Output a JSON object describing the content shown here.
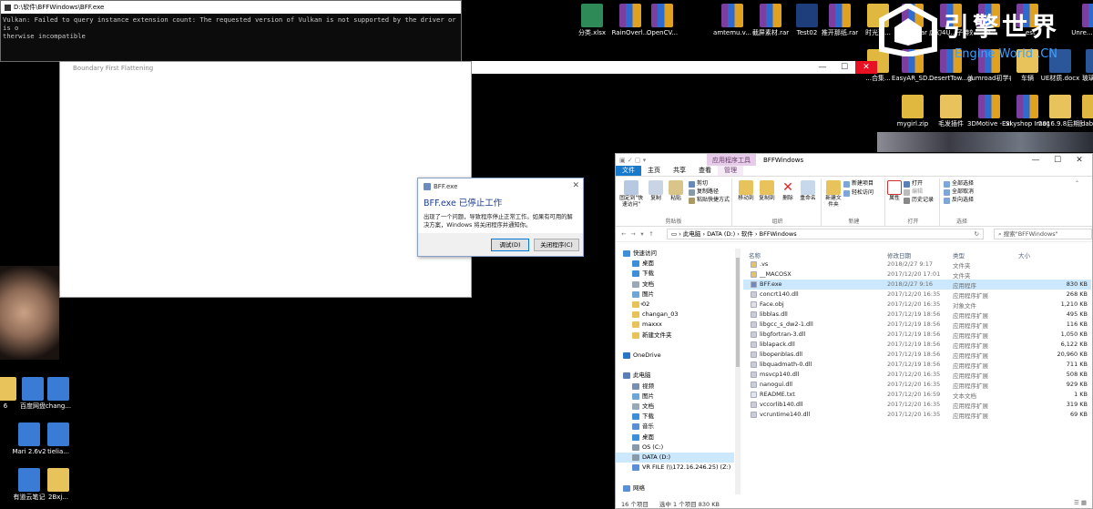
{
  "console": {
    "title": "D:\\软件\\BFFWindows\\BFF.exe",
    "output": "Vulkan: Failed to query instance extension count: The requested version of Vulkan is not supported by the driver or is o\ntherwise incompatible"
  },
  "bff_window": {
    "title": "Boundary First Flattening"
  },
  "dialog": {
    "title": "BFF.exe",
    "heading": "BFF.exe 已停止工作",
    "message": "出现了一个问题，导致程序停止正常工作。如果有可用的解决方案，Windows 将关闭程序并通知你。",
    "debug_label": "调试(D)",
    "close_label": "关闭程序(C)"
  },
  "watermark": {
    "cn": "引擎世界",
    "en": "Engine World .CN"
  },
  "desktop_icons": [
    {
      "label": "分类.xlsx",
      "kind": "xls"
    },
    {
      "label": "RainOverl...",
      "kind": "rar"
    },
    {
      "label": "OpenCV...",
      "kind": "rar"
    },
    {
      "label": "amtemu.v...",
      "kind": "rar"
    },
    {
      "label": "截屏素材.rar",
      "kind": "rar"
    },
    {
      "label": "Test02",
      "kind": "uico"
    },
    {
      "label": "推开那纸.rar",
      "kind": "rar"
    },
    {
      "label": "时光荒...",
      "kind": "zip"
    },
    {
      "label": "game.rar",
      "kind": "rar"
    },
    {
      "label": "虚幻4U...子特效源...",
      "kind": "rar"
    },
    {
      "label": "...4...",
      "kind": "rar"
    },
    {
      "label": "...est",
      "kind": "rar"
    },
    {
      "label": "Unre... Engi...",
      "kind": "rar"
    },
    {
      "label": "...合集...",
      "kind": "zip"
    },
    {
      "label": "EasyAR_SD...",
      "kind": "rar"
    },
    {
      "label": "DesertTow...沙漠村庄.7z",
      "kind": "rar"
    },
    {
      "label": "gumroad初学者场景...",
      "kind": "rar"
    },
    {
      "label": "车辆",
      "kind": "folder"
    },
    {
      "label": "UE材质.docx",
      "kind": "doc"
    },
    {
      "label": "玻璃...pdf",
      "kind": "doc"
    },
    {
      "label": "mygirl.zip",
      "kind": "zip"
    },
    {
      "label": "毛发插件",
      "kind": "folder"
    },
    {
      "label": "3DMotive -Exterior En...",
      "kind": "rar"
    },
    {
      "label": "Skyshop Image-Ba...",
      "kind": "rar"
    },
    {
      "label": "2016.9.8后期图片",
      "kind": "folder"
    },
    {
      "label": "dabai...",
      "kind": "zip"
    },
    {
      "label": "百度网盘",
      "kind": "app"
    },
    {
      "label": "chang...",
      "kind": "app"
    },
    {
      "label": "Mari 2.6v2",
      "kind": "app"
    },
    {
      "label": "tielia...",
      "kind": "app"
    },
    {
      "label": "有道云笔记",
      "kind": "app"
    },
    {
      "label": "2Bxj...",
      "kind": "folder"
    },
    {
      "label": "6",
      "kind": "folder"
    }
  ],
  "explorer": {
    "title": "BFFWindows",
    "context_tab": "应用程序工具",
    "tabs": [
      "文件",
      "主页",
      "共享",
      "查看",
      "管理"
    ],
    "ribbon": {
      "pin": "固定到\"快速访问\"",
      "copy": "复制",
      "paste": "粘贴",
      "cut": "剪切",
      "copy_path": "复制路径",
      "paste_shortcut": "粘贴快捷方式",
      "clipboard": "剪贴板",
      "move_to": "移动到",
      "copy_to": "复制到",
      "delete": "删除",
      "rename": "重命名",
      "organize": "组织",
      "new_folder": "新建文件夹",
      "new_item": "新建项目",
      "easy_access": "轻松访问",
      "new_group": "新建",
      "properties": "属性",
      "open": "打开",
      "edit": "编辑",
      "history": "历史记录",
      "open_group": "打开",
      "select_all": "全部选择",
      "select_none": "全部取消",
      "invert": "反向选择",
      "select_group": "选择"
    },
    "address": [
      "此电脑",
      "DATA (D:)",
      "软件",
      "BFFWindows"
    ],
    "search_placeholder": "搜索\"BFFWindows\"",
    "columns": [
      "名称",
      "修改日期",
      "类型",
      "大小"
    ],
    "nav": [
      {
        "label": "快速访问",
        "level": 0,
        "pin": false,
        "icon": "star"
      },
      {
        "label": "桌面",
        "level": 1,
        "pin": true,
        "icon": "desk"
      },
      {
        "label": "下载",
        "level": 1,
        "pin": true,
        "icon": "dl"
      },
      {
        "label": "文档",
        "level": 1,
        "pin": true,
        "icon": "doc"
      },
      {
        "label": "图片",
        "level": 1,
        "pin": true,
        "icon": "pic"
      },
      {
        "label": "02",
        "level": 1,
        "pin": true,
        "icon": "folder"
      },
      {
        "label": "changan_03",
        "level": 1,
        "pin": false,
        "icon": "folder"
      },
      {
        "label": "maxxx",
        "level": 1,
        "pin": false,
        "icon": "folder"
      },
      {
        "label": "新建文件夹",
        "level": 1,
        "pin": false,
        "icon": "folder"
      },
      {
        "label": "",
        "level": 0,
        "pin": false,
        "icon": "none"
      },
      {
        "label": "OneDrive",
        "level": 0,
        "pin": false,
        "icon": "cloud"
      },
      {
        "label": "",
        "level": 0,
        "pin": false,
        "icon": "none"
      },
      {
        "label": "此电脑",
        "level": 0,
        "pin": false,
        "icon": "pc"
      },
      {
        "label": "视频",
        "level": 1,
        "pin": false,
        "icon": "vid"
      },
      {
        "label": "图片",
        "level": 1,
        "pin": false,
        "icon": "pic"
      },
      {
        "label": "文档",
        "level": 1,
        "pin": false,
        "icon": "doc"
      },
      {
        "label": "下载",
        "level": 1,
        "pin": false,
        "icon": "dl"
      },
      {
        "label": "音乐",
        "level": 1,
        "pin": false,
        "icon": "music"
      },
      {
        "label": "桌面",
        "level": 1,
        "pin": false,
        "icon": "desk"
      },
      {
        "label": "OS (C:)",
        "level": 1,
        "pin": false,
        "icon": "drive"
      },
      {
        "label": "DATA (D:)",
        "level": 1,
        "pin": false,
        "icon": "drive",
        "selected": true
      },
      {
        "label": "VR FILE (\\\\172.16.246.25) (Z:)",
        "level": 1,
        "pin": false,
        "icon": "net"
      },
      {
        "label": "",
        "level": 0,
        "pin": false,
        "icon": "none"
      },
      {
        "label": "网络",
        "level": 0,
        "pin": false,
        "icon": "net"
      }
    ],
    "files": [
      {
        "name": ".vs",
        "date": "2018/2/27 9:17",
        "type": "文件夹",
        "size": "",
        "kind": "folder"
      },
      {
        "name": "__MACOSX",
        "date": "2017/12/20 17:01",
        "type": "文件夹",
        "size": "",
        "kind": "folder"
      },
      {
        "name": "BFF.exe",
        "date": "2018/2/27 9:16",
        "type": "应用程序",
        "size": "830 KB",
        "kind": "exe",
        "selected": true
      },
      {
        "name": "concrt140.dll",
        "date": "2017/12/20 16:35",
        "type": "应用程序扩展",
        "size": "268 KB",
        "kind": "dll"
      },
      {
        "name": "Face.obj",
        "date": "2017/12/20 16:35",
        "type": "对象文件",
        "size": "1,210 KB",
        "kind": "obj"
      },
      {
        "name": "libblas.dll",
        "date": "2017/12/19 18:56",
        "type": "应用程序扩展",
        "size": "495 KB",
        "kind": "dll"
      },
      {
        "name": "libgcc_s_dw2-1.dll",
        "date": "2017/12/19 18:56",
        "type": "应用程序扩展",
        "size": "116 KB",
        "kind": "dll"
      },
      {
        "name": "libgfortran-3.dll",
        "date": "2017/12/19 18:56",
        "type": "应用程序扩展",
        "size": "1,050 KB",
        "kind": "dll"
      },
      {
        "name": "liblapack.dll",
        "date": "2017/12/19 18:56",
        "type": "应用程序扩展",
        "size": "6,122 KB",
        "kind": "dll"
      },
      {
        "name": "libopenblas.dll",
        "date": "2017/12/19 18:56",
        "type": "应用程序扩展",
        "size": "20,960 KB",
        "kind": "dll"
      },
      {
        "name": "libquadmath-0.dll",
        "date": "2017/12/19 18:56",
        "type": "应用程序扩展",
        "size": "711 KB",
        "kind": "dll"
      },
      {
        "name": "msvcp140.dll",
        "date": "2017/12/20 16:35",
        "type": "应用程序扩展",
        "size": "508 KB",
        "kind": "dll"
      },
      {
        "name": "nanogui.dll",
        "date": "2017/12/20 16:35",
        "type": "应用程序扩展",
        "size": "929 KB",
        "kind": "dll"
      },
      {
        "name": "README.txt",
        "date": "2017/12/20 16:59",
        "type": "文本文档",
        "size": "1 KB",
        "kind": "txt"
      },
      {
        "name": "vccorlib140.dll",
        "date": "2017/12/20 16:35",
        "type": "应用程序扩展",
        "size": "319 KB",
        "kind": "dll"
      },
      {
        "name": "vcruntime140.dll",
        "date": "2017/12/20 16:35",
        "type": "应用程序扩展",
        "size": "69 KB",
        "kind": "dll"
      }
    ],
    "status": {
      "count": "16 个项目",
      "selected": "选中 1 个项目  830 KB"
    }
  }
}
